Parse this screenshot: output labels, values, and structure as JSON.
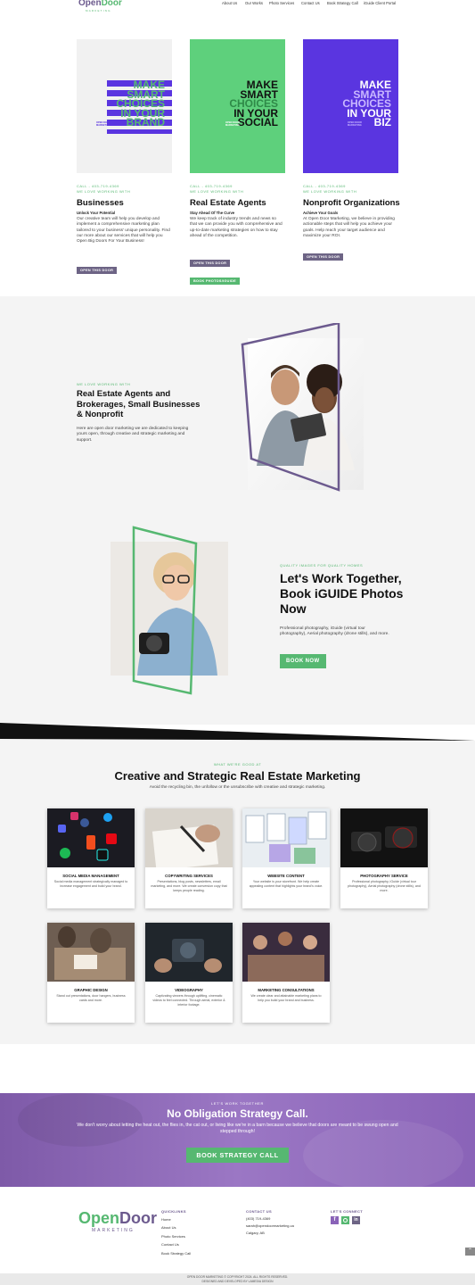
{
  "header": {
    "logo_open": "Open",
    "logo_door": "Door",
    "logo_sub": "MARKETING",
    "nav": [
      "About Us",
      "Our Works",
      "Photo Services",
      "Contact Us",
      "Book Strategy Call",
      "iGuide Client Portal"
    ]
  },
  "cards": [
    {
      "image_lines": [
        "MAKE",
        "SMART",
        "CHOICES",
        "IN YOUR",
        "BRAND"
      ],
      "image_small": "OPEN DOOR MARKETING",
      "phone": "CALL - 403-719-4369",
      "kicker": "WE LOVE WORKING WITH",
      "title": "Businesses",
      "subtitle": "Unlock Your Potential",
      "body": "Our creative team will help you develop and implement a comprehensive marketing plan tailored to your business' unique personality. Find our more about our services that will help you Open Big Doors For Your Business!",
      "buttons": [
        "OPEN THIS DOOR"
      ]
    },
    {
      "image_lines": [
        "MAKE",
        "SMART",
        "CHOICES",
        "IN YOUR",
        "SOCIAL"
      ],
      "image_small": "OPEN DOOR MARKETING",
      "phone": "CALL - 403-719-4369",
      "kicker": "WE LOVE WORKING WITH",
      "title": "Real Estate Agents",
      "subtitle": "Stay Ahead Of The Curve",
      "body": "We keep track of industry trends and news so that we can provide you with comprehensive and up-to-date marketing strategies on how to stay ahead of the competition.",
      "buttons": [
        "OPEN THIS DOOR",
        "BOOK PHOTOS/IGUIDE"
      ]
    },
    {
      "image_lines": [
        "MAKE",
        "SMART",
        "CHOICES",
        "IN YOUR",
        "BIZ"
      ],
      "image_small": "OPEN DOOR MARKETING",
      "phone": "CALL - 403-719-4369",
      "kicker": "WE LOVE WORKING WITH",
      "title": "Nonprofit Organizations",
      "subtitle": "Achieve Your Goals",
      "body": "At Open Door Marketing, we believe in providing actionable steps that will help you achieve your goals. Help reach your target audience and maximize your ROI.",
      "buttons": [
        "OPEN THIS DOOR"
      ]
    }
  ],
  "about": {
    "kicker": "WE LOVE WORKING WITH",
    "title": "Real Estate Agents and Brokerages, Small Businesses & Nonprofit",
    "body": "Here are open door marketing we are dedicated to keeping yours open, through creative and strategic marketing and support."
  },
  "photo": {
    "kicker": "QUALITY IMAGES FOR QUALITY HOMES",
    "title": "Let's Work Together, Book iGUIDE Photos Now",
    "body": "Professional photography, iGuide (virtual tour photography), Aerial photography (drone stills), and more.",
    "button": "BOOK NOW"
  },
  "services": {
    "kicker": "WHAT WE'RE GOOD AT",
    "title": "Creative and Strategic Real Estate Marketing",
    "subtitle": "Avoid the recycling bin, the unfollow or the unsubscribe with creative and strategic marketing.",
    "items": [
      {
        "title": "SOCIAL MEDIA MANAGEMENT",
        "desc": "Social media management strategically managed to increase engagement and build your brand."
      },
      {
        "title": "COPYWRITING SERVICES",
        "desc": "Presentations, blog posts, newsletters, email marketing, and more. We create conversion copy that keeps people reading."
      },
      {
        "title": "WEBSITE CONTENT",
        "desc": "Your website is your storefront. We help create appealing content that highlights your brand's voice."
      },
      {
        "title": "PHOTOGRAPHY SERVICE",
        "desc": "Professional photography, iGuide (virtual tour photography), Aerial photography (drone stills), and more."
      },
      {
        "title": "GRAPHIC DESIGN",
        "desc": "Stand out presentations, door hangers, business cards and more."
      },
      {
        "title": "VIDEOGRAPHY",
        "desc": "Captivating viewers through uplifting, cinematic videos to feel connected. Through aerial, exterior & interior footage."
      },
      {
        "title": "MARKETING CONSULTATIONS",
        "desc": "We create clear and attainable marketing plans to help you build your brand and business."
      }
    ]
  },
  "cta": {
    "kicker": "LET'S WORK TOGETHER",
    "title": "No Obligation Strategy Call.",
    "body": "We don't worry about letting the heat out, the flies in, the cat out, or living like we're in a barn because we believe that doors are meant to be swung open and stepped through!",
    "button": "BOOK STRATEGY CALL"
  },
  "footer": {
    "quicklinks_title": "QUICKLINKS",
    "quicklinks": [
      "Home",
      "About Us",
      "Photo Services",
      "Contact Us",
      "Book Strategy Call"
    ],
    "contact_title": "CONTACT US",
    "contact": [
      "(403) 719-4369",
      "sarah@opendoormarketing.ca",
      "Calgary, AB"
    ],
    "connect_title": "LET'S CONNECT",
    "copyright": "OPEN DOOR MARKETING © COPYRIGHT 2024. ALL RIGHTS RESERVED.",
    "developer": "DESIGNED AND DEVELOPED BY LAMEDIA DESIGN"
  },
  "colors": {
    "purple": "#6c5a8e",
    "green": "#56b871",
    "violet": "#5a35e0",
    "cta_purple": "#8a63b8"
  }
}
